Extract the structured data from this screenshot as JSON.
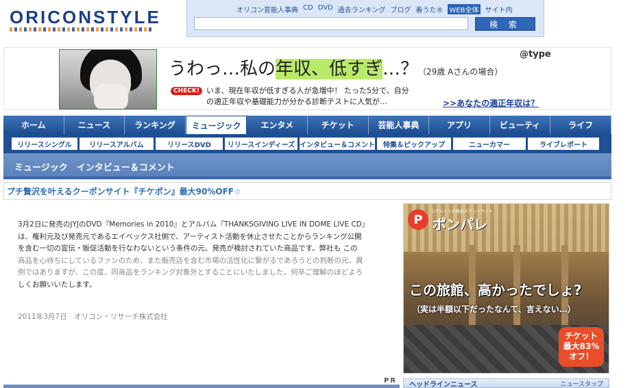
{
  "header": {
    "logo_text": "ORICONSTYLE",
    "search_links": [
      "オリコン芸能人事典",
      "CD",
      "DVD",
      "過去ランキング",
      "ブログ",
      "着うた®",
      "WEB全体",
      "サイト内"
    ],
    "search_placeholder": "",
    "search_button": "検 索"
  },
  "banner": {
    "brand": "@type",
    "headline_a": "うわっ…私の",
    "headline_hl": "年収、低すぎ",
    "headline_b": "…？",
    "headline_sub": "（29歳 Aさんの場合）",
    "check_label": "CHECK!",
    "body_line1": "いま、現在年収が低すぎる人が急増中！ たった5分で、自分",
    "body_line2": "の適正年収や基礎能力が分かる診断テストに人気が…",
    "cta": ">>あなたの適正年収は？"
  },
  "nav": {
    "main_tabs": [
      "ホーム",
      "ニュース",
      "ランキング",
      "ミュージック",
      "エンタメ",
      "チケット",
      "芸能人事典",
      "アプリ",
      "ビューティ",
      "ライフ"
    ],
    "active_tab": "ミュージック",
    "sub_tabs": [
      "リリースシングル",
      "リリースアルバム",
      "リリースDVD",
      "リリースインディーズ",
      "インタビュー＆コメント",
      "特集＆ピックアップ",
      "ニューカマー",
      "ライブレポート"
    ]
  },
  "section": {
    "title": "ミュージック　インタビュー＆コメント"
  },
  "pr_strip": {
    "text": "プチ贅沢を叶えるクーポンサイト『チケポン』最大90%OFF☆"
  },
  "article": {
    "line1": "3月2日に発売のJYJのDVD『Memories in 2010』とアルバム『THANKSGIVING LIVE IN DOME LIVE CD』",
    "line2": "は、権利元及び発売元であるエイベックス社側で、アーティスト活動を休止させたことからランキング公開",
    "line3": "を含む一切の宣伝・販促活動を行なわないという条件の元、発売が検討されていた商品です。弊社も この",
    "line4": "商品を心待ちにしているファンのため、また販売店を含む市場の活性化に繋がるであろうとの判断の元、異",
    "line5": "例ではありますが、この度、同商品をランキング対象外とすることにいたしました。何卒ご理解のほどよろ",
    "line6": "しくお願いいたします。",
    "date": "2011年3月7日　オリコン・リサーチ株式会社"
  },
  "pr_label": "PR",
  "side_ad": {
    "tagline": "リクルートの格安チケットサイト",
    "brand": "ポンパレ",
    "headline": "この旅館、高かったでしょ?",
    "subline": "（実は半額以下だったなんて、言えない…）",
    "badge_line1": "チケット",
    "badge_line2": "最大83%",
    "badge_line3": "オフ！"
  },
  "side_headline": {
    "title": "ヘッドラインニュース",
    "more": "ニュースタップ"
  }
}
